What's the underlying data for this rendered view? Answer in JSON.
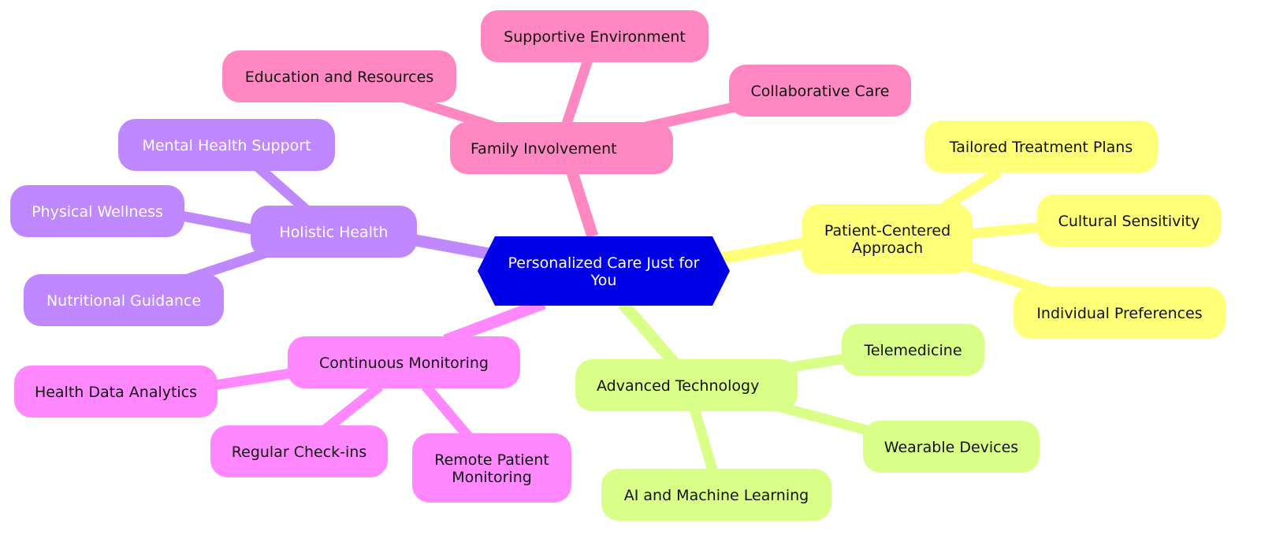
{
  "title": "Personalized Care Just for You",
  "root": {
    "label": "Personalized Care Just for You",
    "color": "#0000e6",
    "text_color": "#ffffff"
  },
  "branches": [
    {
      "id": "family-involvement",
      "label": "Family Involvement",
      "color": "#ff88c2",
      "text_color": "#111111",
      "children": [
        {
          "id": "education-and-resources",
          "label": "Education and Resources"
        },
        {
          "id": "supportive-environment",
          "label": "Supportive Environment"
        },
        {
          "id": "collaborative-care",
          "label": "Collaborative Care"
        }
      ]
    },
    {
      "id": "holistic-health",
      "label": "Holistic Health",
      "color": "#c088ff",
      "text_color": "#ffffff",
      "children": [
        {
          "id": "mental-health-support",
          "label": "Mental Health Support"
        },
        {
          "id": "physical-wellness",
          "label": "Physical Wellness"
        },
        {
          "id": "nutritional-guidance",
          "label": "Nutritional Guidance"
        }
      ]
    },
    {
      "id": "patient-centered-approach",
      "label": "Patient-Centered Approach",
      "color": "#ffff78",
      "text_color": "#111111",
      "children": [
        {
          "id": "tailored-treatment-plans",
          "label": "Tailored Treatment Plans"
        },
        {
          "id": "cultural-sensitivity",
          "label": "Cultural Sensitivity"
        },
        {
          "id": "individual-preferences",
          "label": "Individual Preferences"
        }
      ]
    },
    {
      "id": "continuous-monitoring",
      "label": "Continuous Monitoring",
      "color": "#ff88ff",
      "text_color": "#111111",
      "children": [
        {
          "id": "health-data-analytics",
          "label": "Health Data Analytics"
        },
        {
          "id": "regular-check-ins",
          "label": "Regular Check-ins"
        },
        {
          "id": "remote-patient-monitoring",
          "label": "Remote Patient Monitoring"
        }
      ]
    },
    {
      "id": "advanced-technology",
      "label": "Advanced Technology",
      "color": "#d9ff88",
      "text_color": "#111111",
      "children": [
        {
          "id": "telemedicine",
          "label": "Telemedicine"
        },
        {
          "id": "wearable-devices",
          "label": "Wearable Devices"
        },
        {
          "id": "ai-and-machine-learning",
          "label": "AI and Machine Learning"
        }
      ]
    }
  ]
}
